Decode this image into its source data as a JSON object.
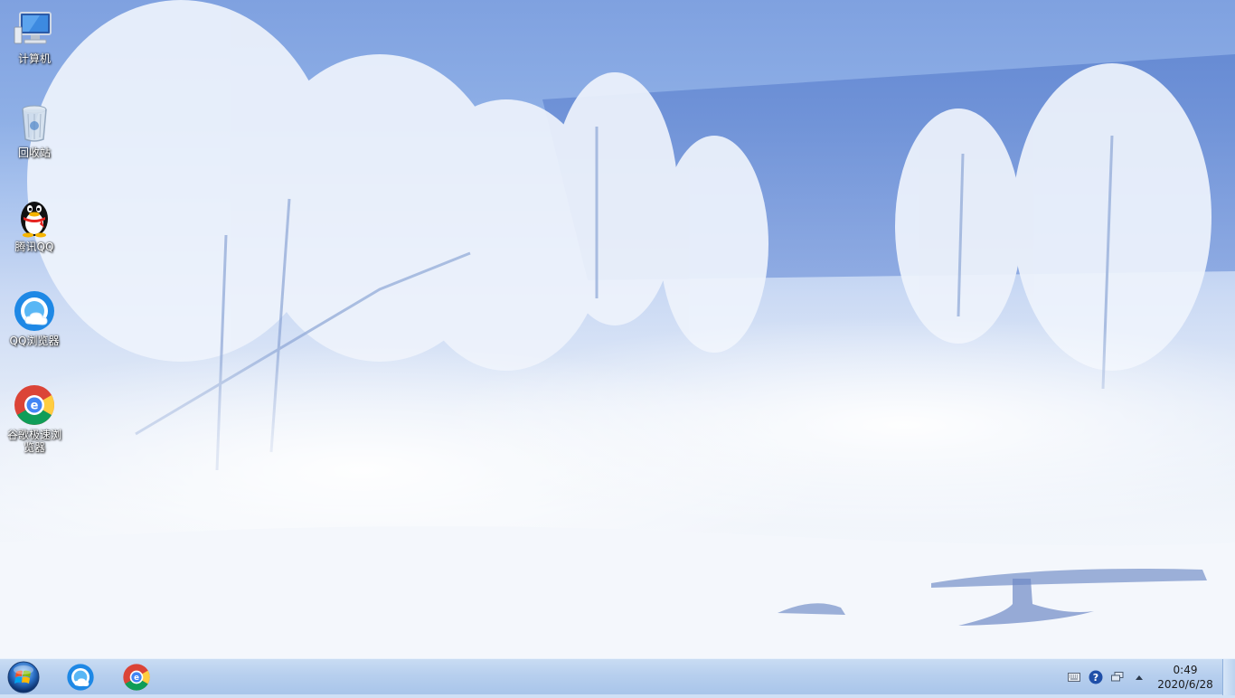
{
  "desktop": {
    "icons": [
      {
        "label": "计算机",
        "icon": "computer-icon"
      },
      {
        "label": "回收站",
        "icon": "recycle-bin-icon"
      },
      {
        "label": "腾讯QQ",
        "icon": "qq-penguin-icon"
      },
      {
        "label": "QQ浏览器",
        "icon": "qq-browser-icon"
      },
      {
        "label": "谷歌极速浏览器",
        "icon": "chrome-browser-icon"
      }
    ]
  },
  "taskbar": {
    "start_icon": "windows-start-orb",
    "pinned": [
      {
        "name": "QQ浏览器",
        "icon": "qq-browser-icon"
      },
      {
        "name": "谷歌极速浏览器",
        "icon": "chrome-browser-icon"
      }
    ],
    "tray": {
      "icons": [
        "keyboard-icon",
        "help-icon",
        "network-icon",
        "show-hidden-icons-arrow"
      ],
      "time": "0:49",
      "date": "2020/6/28"
    }
  },
  "colors": {
    "taskbar": "#b7cfee",
    "sky": "#7fa1e0",
    "snow": "#f4f7fc"
  }
}
